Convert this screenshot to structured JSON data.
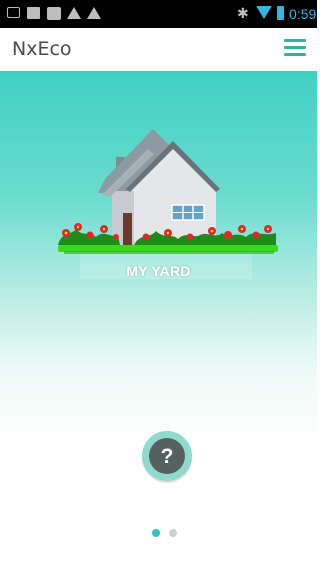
{
  "status_bar": {
    "time": "0:59",
    "icons": [
      "voicemail-icon",
      "image-icon",
      "app-notification-icon",
      "warning-icon",
      "warning-icon",
      "bluetooth-icon",
      "wifi-icon",
      "battery-icon"
    ]
  },
  "app_bar": {
    "title": "NxEco",
    "menu_icon": "hamburger-menu-icon"
  },
  "carousel": {
    "slide_label": "MY YARD",
    "help_label": "?",
    "page_count": 2,
    "active_page": 1
  },
  "colors": {
    "accent": "#36b39a",
    "gradient_top": "#3fd0c2",
    "status_blue": "#33b5e5",
    "dot_active": "#2fc5c0",
    "dot_inactive": "#cfcfcf"
  }
}
